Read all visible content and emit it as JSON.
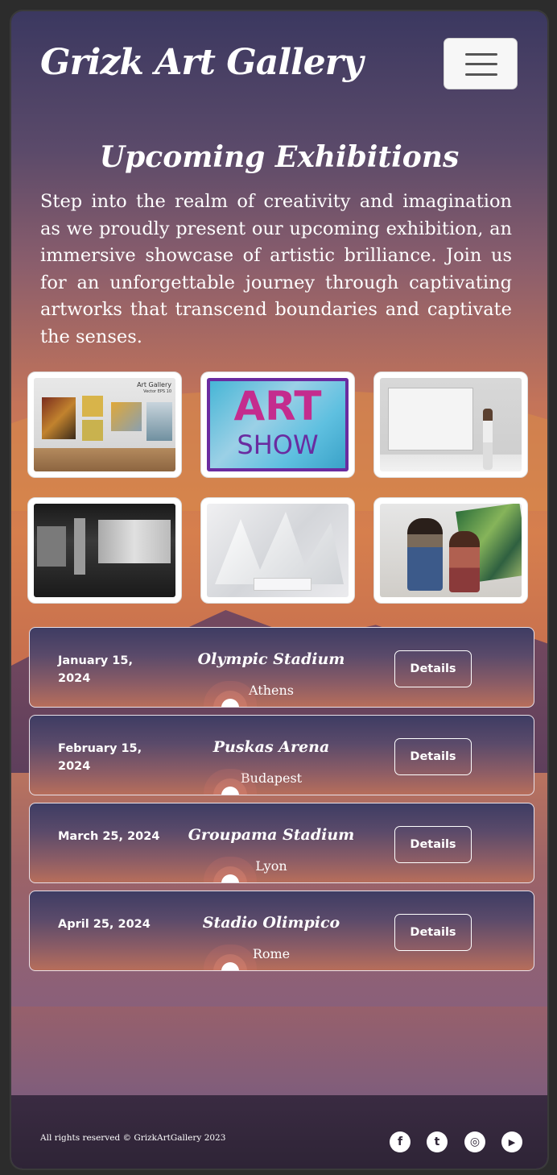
{
  "header": {
    "brand": "Grizk Art Gallery",
    "menu_icon": "hamburger-icon"
  },
  "hero": {
    "title": "Upcoming Exhibitions",
    "intro": "Step into the realm of creativity and imagination as we proudly present our upcoming exhibition, an immersive showcase of artistic brilliance. Join us for an unforgettable journey through captivating artworks that transcend boundaries and captivate the senses."
  },
  "gallery": {
    "thumb1": {
      "label": "Art Gallery",
      "sublabel": "Vector EPS 10"
    },
    "thumb2": {
      "line1": "ART",
      "line2": "SHOW"
    }
  },
  "events": [
    {
      "date": "January 15, 2024",
      "venue": "Olympic Stadium",
      "city": "Athens",
      "button": "Details"
    },
    {
      "date": "February 15, 2024",
      "venue": "Puskas Arena",
      "city": "Budapest",
      "button": "Details"
    },
    {
      "date": "March 25, 2024",
      "venue": "Groupama Stadium",
      "city": "Lyon",
      "button": "Details"
    },
    {
      "date": "April 25, 2024",
      "venue": "Stadio Olimpico",
      "city": "Rome",
      "button": "Details"
    }
  ],
  "footer": {
    "copyright": "All rights reserved © GrizkArtGallery 2023",
    "social": [
      {
        "icon": "facebook-icon",
        "glyph": "f"
      },
      {
        "icon": "twitter-icon",
        "glyph": "t"
      },
      {
        "icon": "instagram-icon",
        "glyph": "◎"
      },
      {
        "icon": "youtube-icon",
        "glyph": "▶"
      }
    ]
  }
}
